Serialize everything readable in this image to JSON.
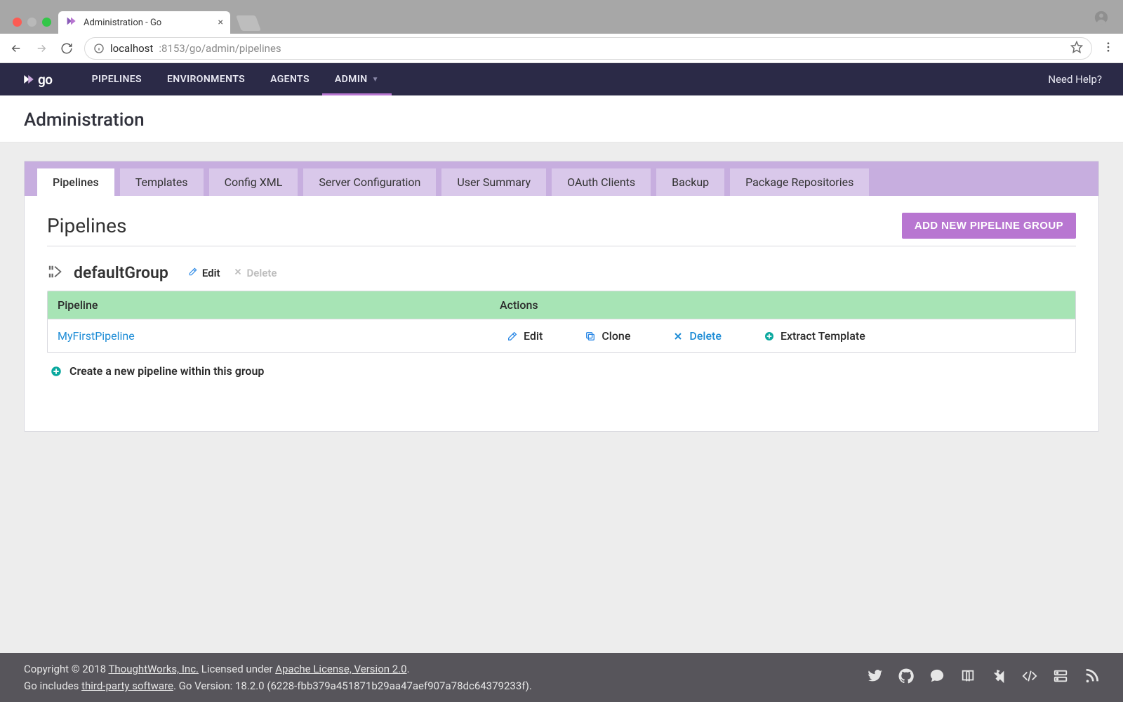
{
  "browser": {
    "tab_title": "Administration - Go",
    "url_host": "localhost",
    "url_port_path": ":8153/go/admin/pipelines"
  },
  "nav": {
    "logo_text": "go",
    "items": [
      "PIPELINES",
      "ENVIRONMENTS",
      "AGENTS",
      "ADMIN"
    ],
    "active_index": 3,
    "help_label": "Need Help?"
  },
  "page": {
    "title": "Administration"
  },
  "admin_tabs": {
    "items": [
      "Pipelines",
      "Templates",
      "Config XML",
      "Server Configuration",
      "User Summary",
      "OAuth Clients",
      "Backup",
      "Package Repositories"
    ],
    "active_index": 0
  },
  "section": {
    "heading": "Pipelines",
    "add_group_button": "ADD NEW PIPELINE GROUP"
  },
  "group": {
    "name": "defaultGroup",
    "edit_label": "Edit",
    "delete_label": "Delete",
    "table": {
      "col_pipeline": "Pipeline",
      "col_actions": "Actions",
      "rows": [
        {
          "name": "MyFirstPipeline",
          "edit": "Edit",
          "clone": "Clone",
          "delete": "Delete",
          "extract": "Extract Template"
        }
      ]
    },
    "create_label": "Create a new pipeline within this group"
  },
  "footer": {
    "copyright_prefix": "Copyright © 2018 ",
    "thoughtworks": "ThoughtWorks, Inc.",
    "licensed_under": " Licensed under ",
    "apache": "Apache License, Version 2.0",
    "period": ".",
    "go_includes": "Go includes ",
    "third_party": "third-party software",
    "version_text": ". Go Version: 18.2.0 (6228-fbb379a451871b29aa47aef907a78dc64379233f)."
  }
}
